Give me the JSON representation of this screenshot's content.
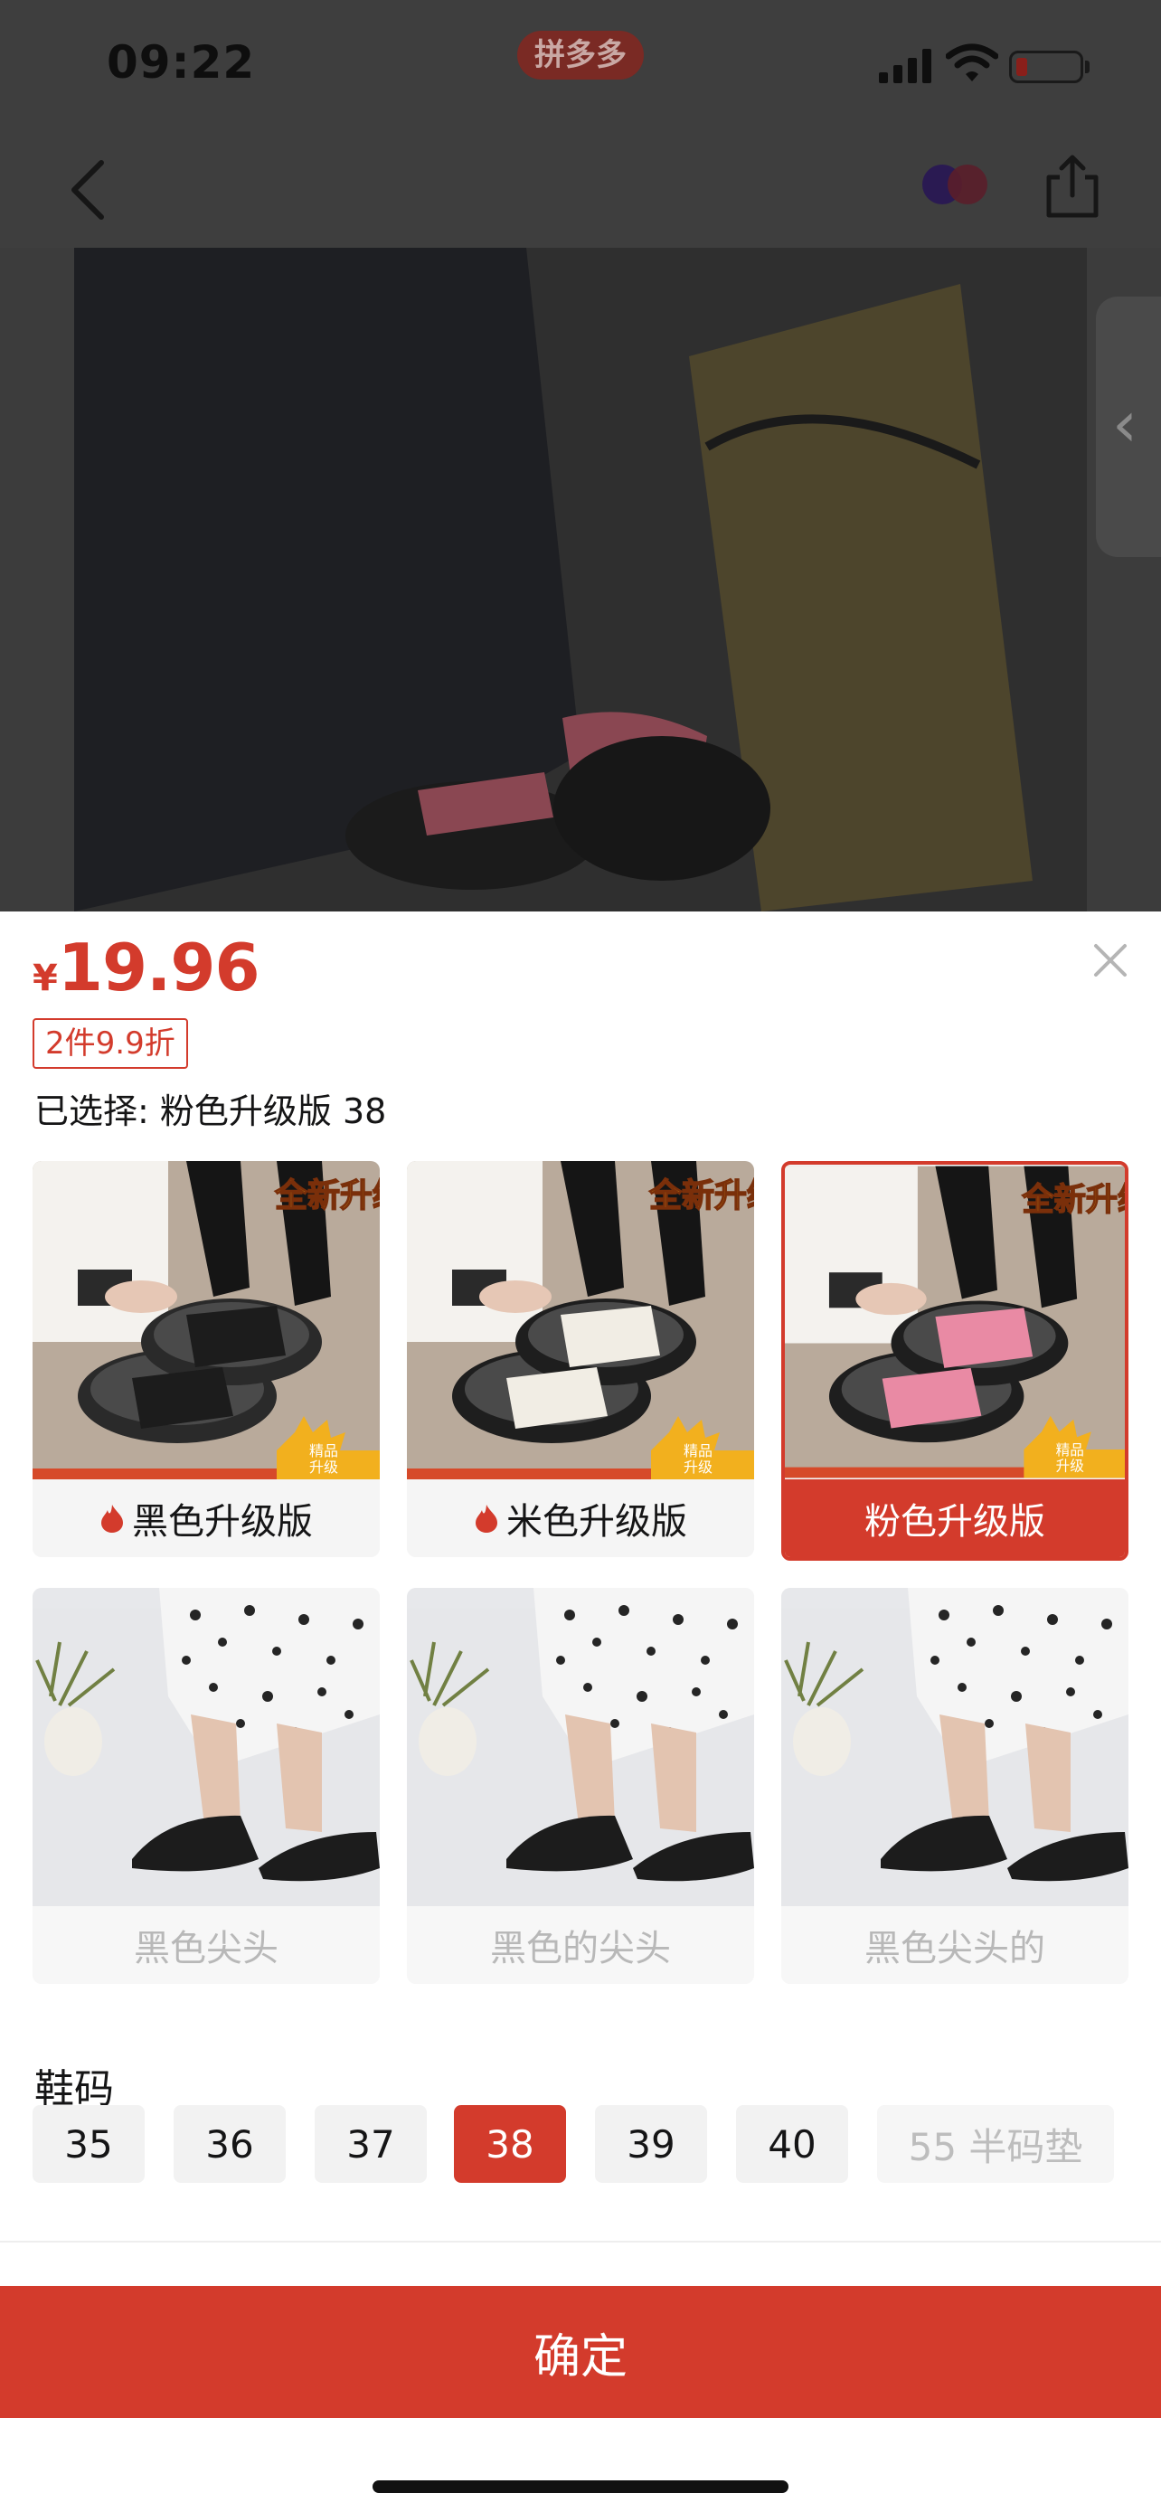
{
  "status_bar": {
    "time": "09:22",
    "app_pill": "拼多多"
  },
  "product": {
    "price_symbol": "¥",
    "price": "19.96",
    "discount_tag": "2件9.9折",
    "selected_label": "已选择: 粉色升级版 38"
  },
  "variants": [
    {
      "label": "黑色升级版",
      "hot": true,
      "state": "normal",
      "shoe_color": "#1c1c1c",
      "sole_color": "#2a2a2a"
    },
    {
      "label": "米色升级版",
      "hot": true,
      "state": "normal",
      "shoe_color": "#f1ede4",
      "sole_color": "#1e1e1e"
    },
    {
      "label": "粉色升级版",
      "hot": false,
      "state": "selected",
      "shoe_color": "#e98aa4",
      "sole_color": "#1e1e1e"
    },
    {
      "label": "黑色尖头",
      "hot": false,
      "state": "disabled"
    },
    {
      "label": "黑色的尖头",
      "hot": false,
      "state": "disabled"
    },
    {
      "label": "黑色尖头的",
      "hot": false,
      "state": "disabled"
    }
  ],
  "badge_text": "全新升级",
  "badge_small": "精品升级",
  "size": {
    "title": "鞋码",
    "options": [
      {
        "label": "35",
        "state": "normal"
      },
      {
        "label": "36",
        "state": "normal"
      },
      {
        "label": "37",
        "state": "normal"
      },
      {
        "label": "38",
        "state": "selected"
      },
      {
        "label": "39",
        "state": "normal"
      },
      {
        "label": "40",
        "state": "normal"
      },
      {
        "label": "55 半码垫",
        "state": "disabled"
      }
    ]
  },
  "confirm_label": "确定",
  "colors": {
    "accent": "#d33b2c",
    "chip_bg": "#f2f2f2",
    "overlay": "#3c3c3c"
  }
}
